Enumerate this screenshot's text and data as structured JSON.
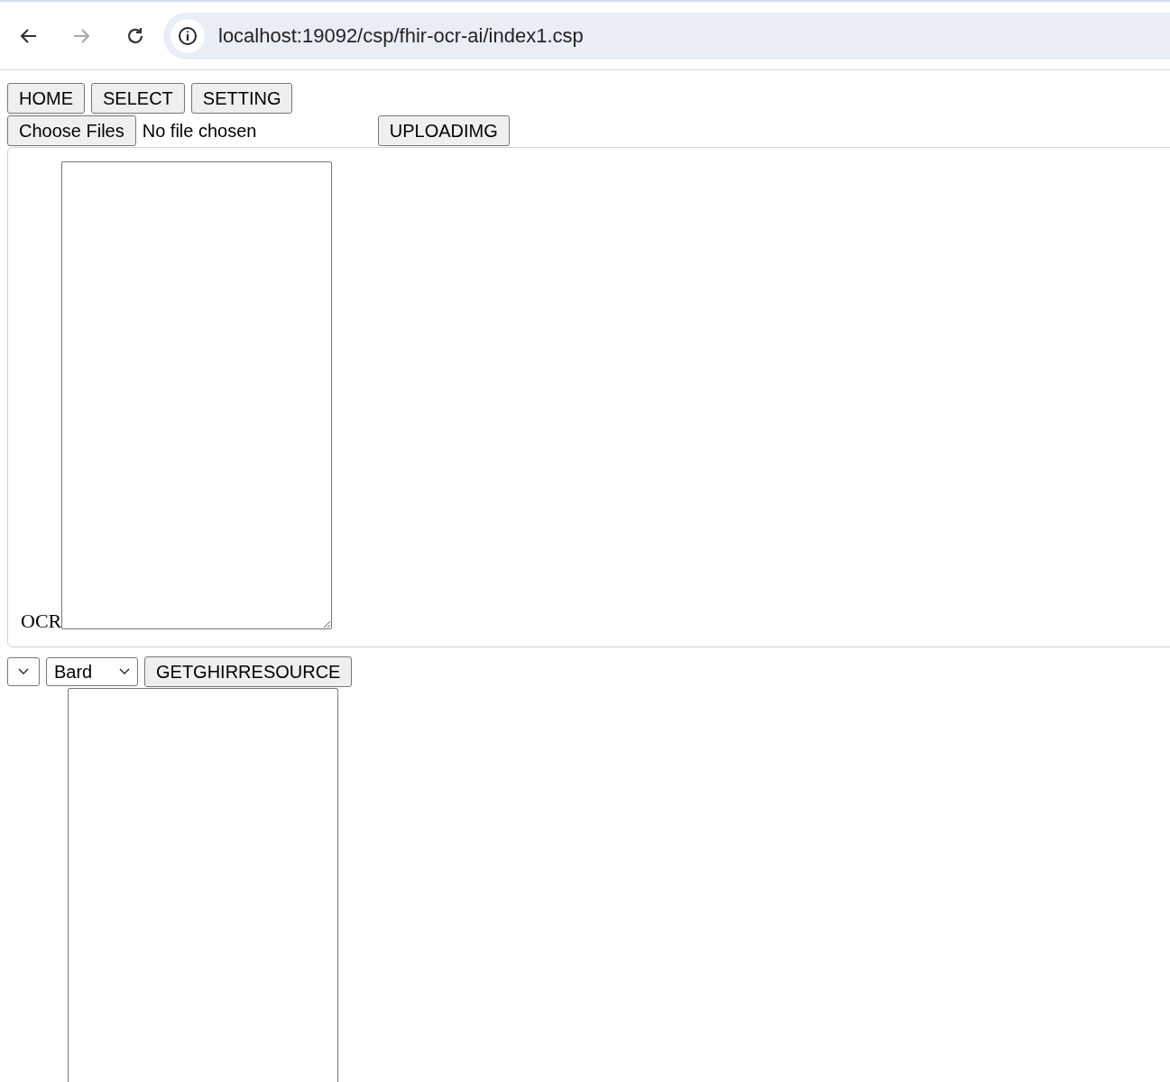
{
  "browser": {
    "url": "localhost:19092/csp/fhir-ocr-ai/index1.csp",
    "forward_disabled": true
  },
  "nav_buttons": [
    "HOME",
    "SELECT",
    "SETTING"
  ],
  "file_input": {
    "button": "Choose Files",
    "status": "No file chosen"
  },
  "upload_button": "UPLOADIMG",
  "ocr_panel": {
    "label": "OCR"
  },
  "model_row": {
    "select_2": {
      "value": "Bard"
    },
    "button": "GETGHIRRESOURCE"
  }
}
